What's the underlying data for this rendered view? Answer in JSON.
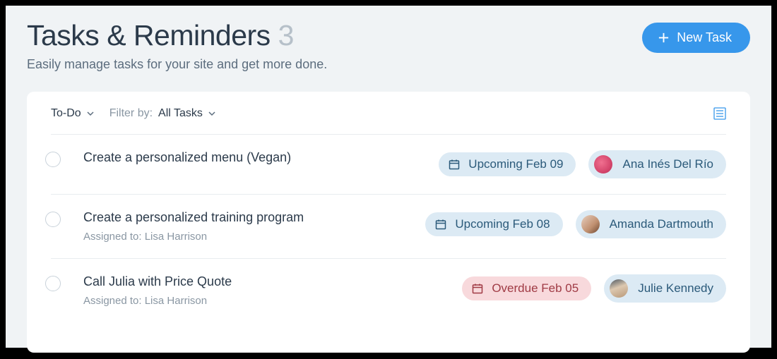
{
  "header": {
    "title": "Tasks & Reminders",
    "count": "3",
    "subtitle": "Easily manage tasks for your site and get more done.",
    "new_task_label": "New Task"
  },
  "filters": {
    "status": "To-Do",
    "filter_by_label": "Filter by:",
    "filter_value": "All Tasks"
  },
  "tasks": [
    {
      "title": "Create a personalized menu (Vegan)",
      "assigned_to": "",
      "date_label": "Upcoming Feb 09",
      "date_status": "upcoming",
      "assignee": "Ana Inés Del Río",
      "avatar_class": "ana"
    },
    {
      "title": "Create a personalized training program",
      "assigned_to": "Assigned to: Lisa Harrison",
      "date_label": "Upcoming Feb 08",
      "date_status": "upcoming",
      "assignee": "Amanda Dartmouth",
      "avatar_class": "amanda"
    },
    {
      "title": "Call Julia with Price Quote",
      "assigned_to": "Assigned to: Lisa Harrison",
      "date_label": "Overdue Feb 05",
      "date_status": "overdue",
      "assignee": "Julie Kennedy",
      "avatar_class": "julie"
    }
  ]
}
